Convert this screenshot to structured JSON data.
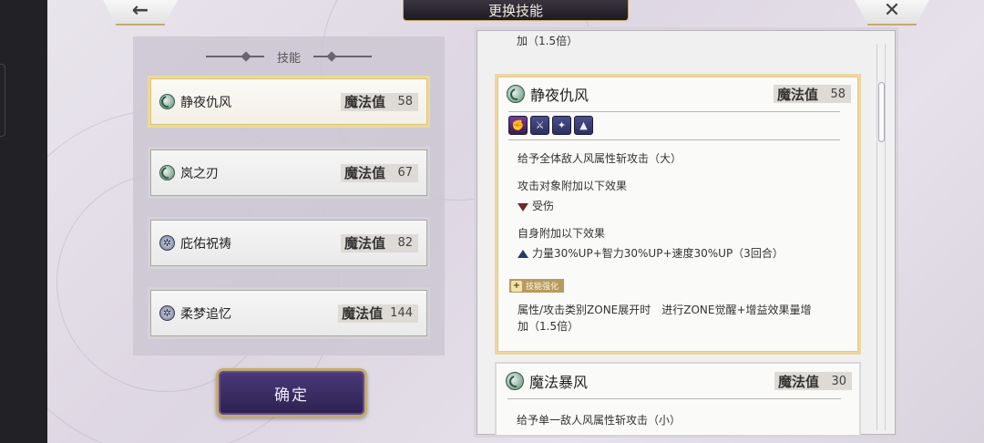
{
  "header": {
    "title": "更换技能",
    "back_icon": "←",
    "close_icon": "✕"
  },
  "left_panel": {
    "heading": "技能",
    "skills": [
      {
        "name": "静夜仇风",
        "mp_label": "魔法值",
        "mp": "58",
        "icon": "wind-icon",
        "selected": true
      },
      {
        "name": "岚之刃",
        "mp_label": "魔法值",
        "mp": "67",
        "icon": "wind-icon",
        "selected": false
      },
      {
        "name": "庇佑祝祷",
        "mp_label": "魔法值",
        "mp": "82",
        "icon": "star-icon",
        "selected": false
      },
      {
        "name": "柔梦追忆",
        "mp_label": "魔法值",
        "mp": "144",
        "icon": "star-icon",
        "selected": false
      }
    ],
    "confirm_label": "确定"
  },
  "right_panel": {
    "partial_top_text": "加（1.5倍）",
    "details": [
      {
        "name": "静夜仇风",
        "mp_label": "魔法值",
        "mp": "58",
        "icon": "wind-icon",
        "badges": [
          "fist-icon",
          "sword-icon",
          "magic-sword-icon",
          "boot-icon"
        ],
        "line1": "给予全体敌人风属性斩攻击（大）",
        "target_heading": "攻击对象附加以下效果",
        "target_effect": "受伤",
        "self_heading": "自身附加以下效果",
        "self_effect": "力量30%UP+智力30%UP+速度30%UP（3回合）",
        "enhance_tag": "技能强化",
        "enhance_text_1": "属性/攻击类别ZONE展开时　进行ZONE觉醒+增益效果量增",
        "enhance_text_2": "加（1.5倍）"
      },
      {
        "name": "魔法暴风",
        "mp_label": "魔法值",
        "mp": "30",
        "icon": "wind-icon",
        "line1": "给予单一敌人风属性斩攻击（小）"
      }
    ]
  }
}
